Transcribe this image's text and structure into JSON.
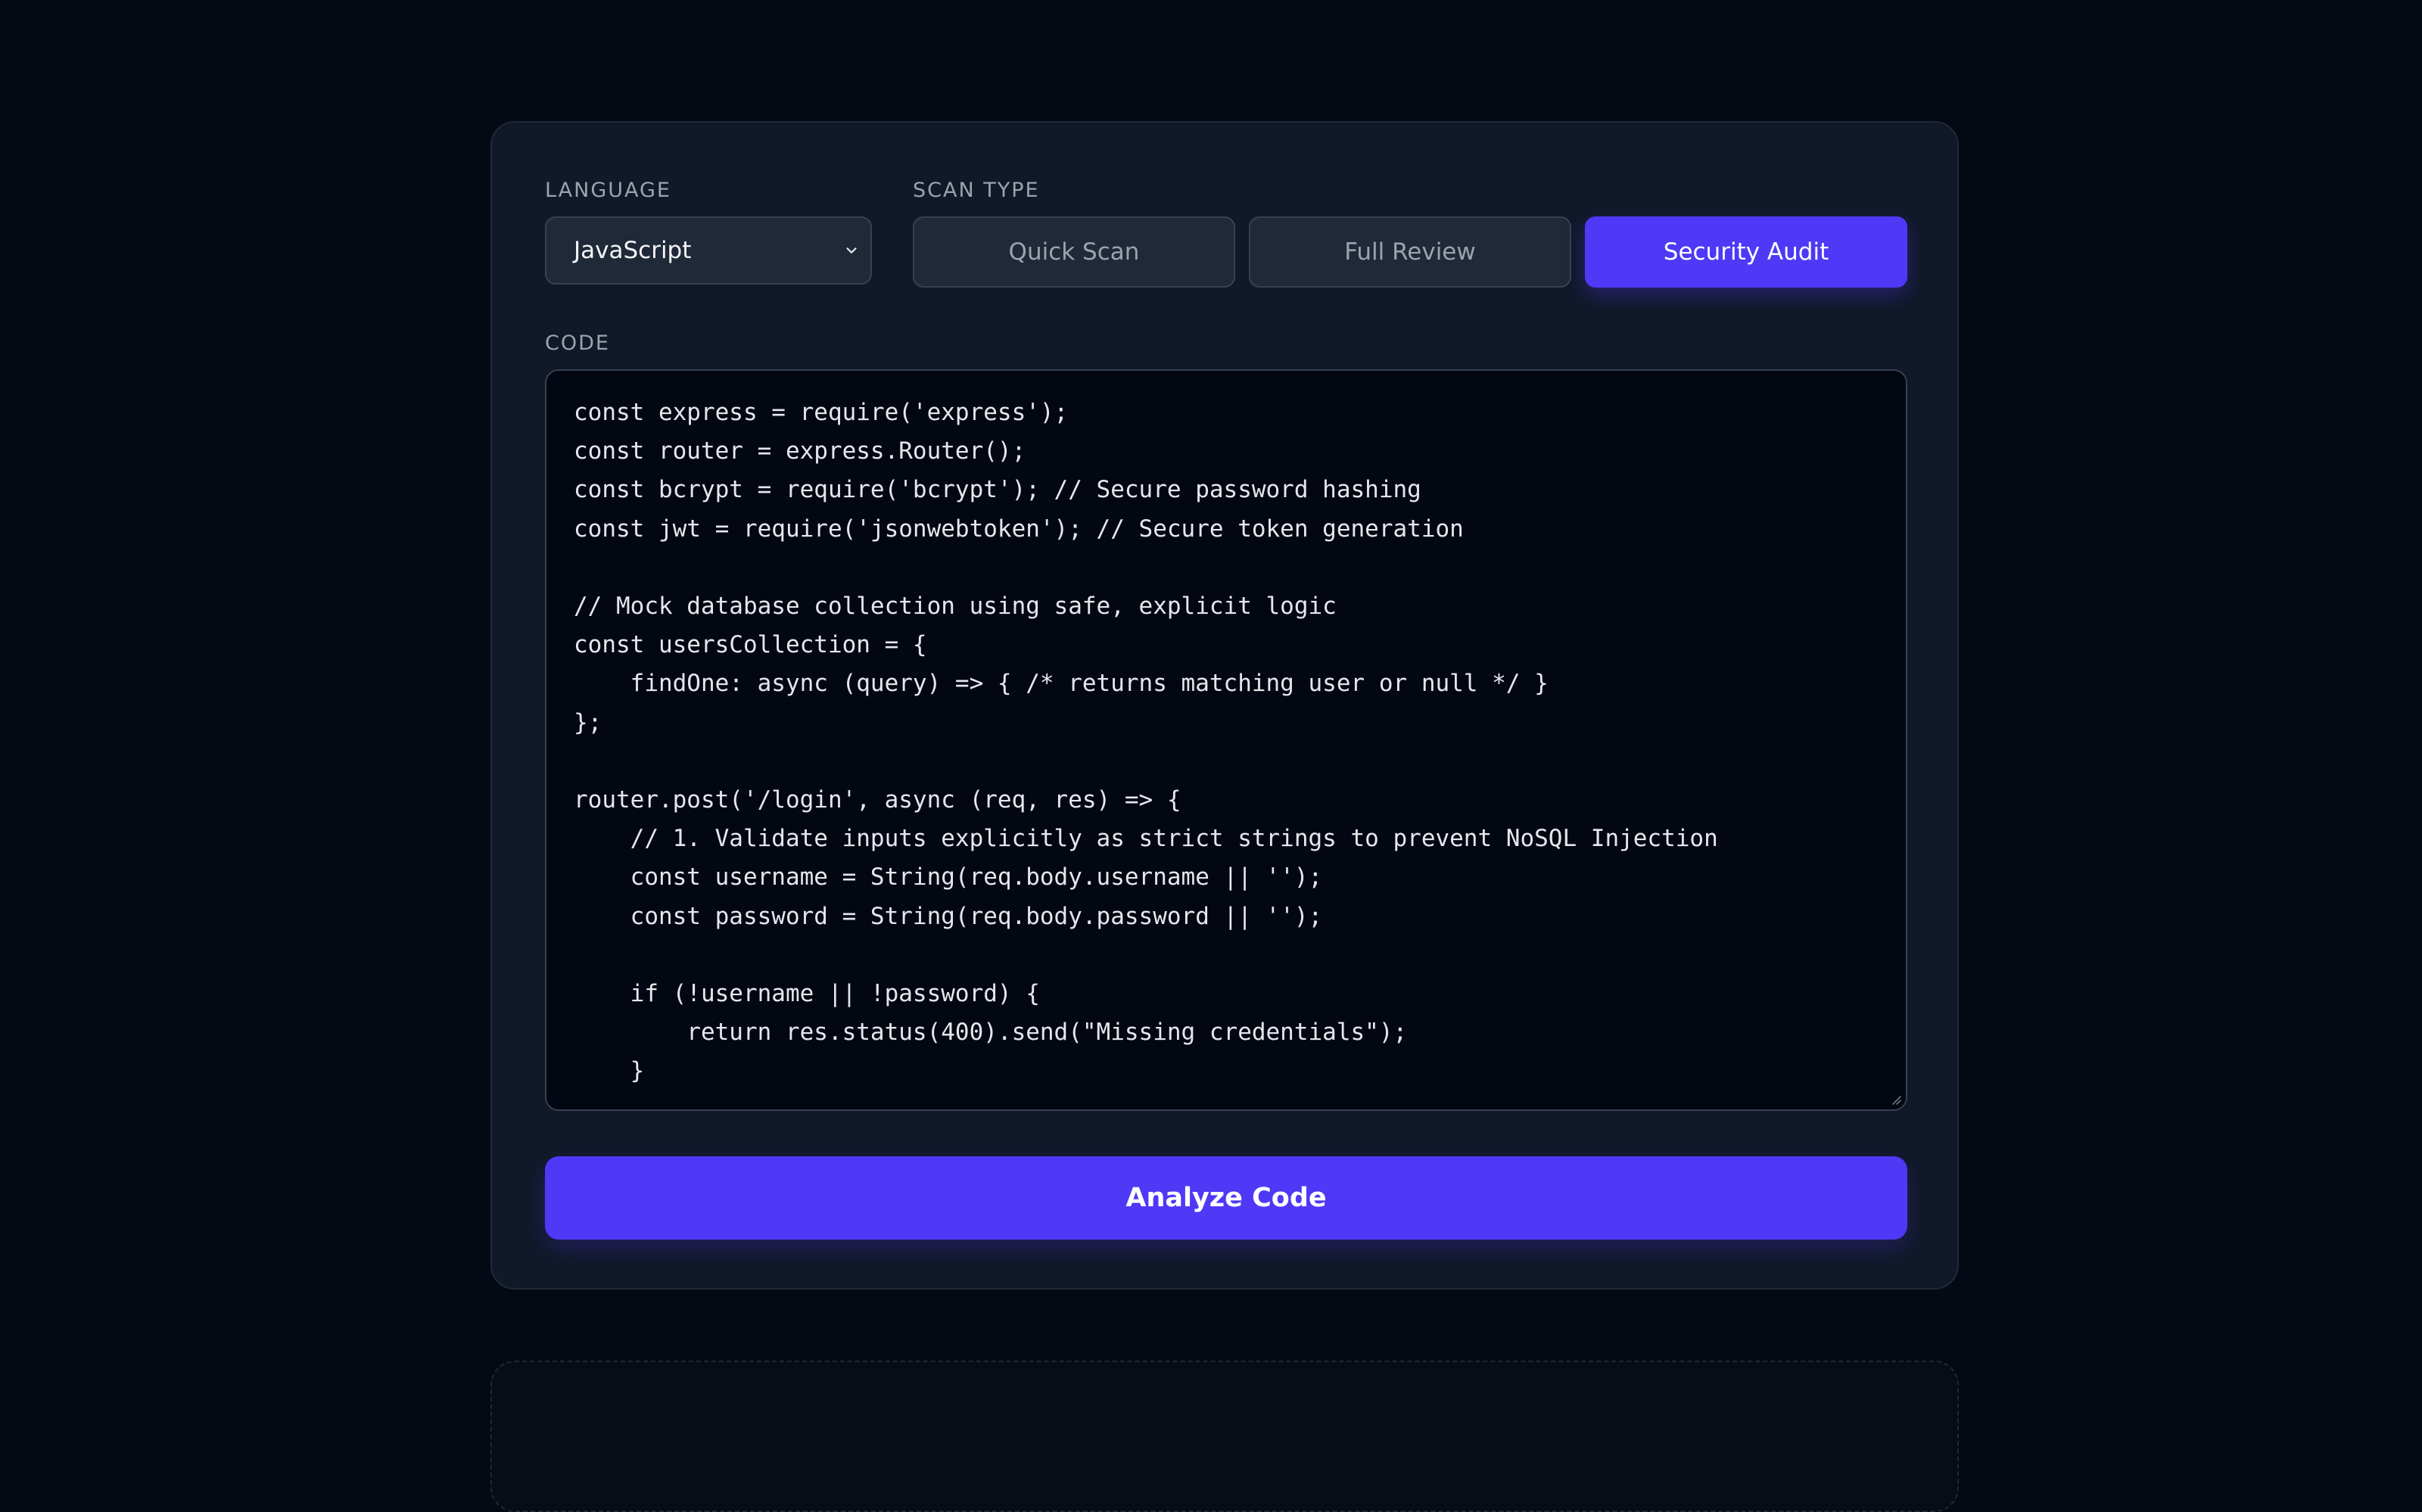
{
  "form": {
    "language_label": "LANGUAGE",
    "language_value": "JavaScript",
    "scan_type_label": "SCAN TYPE",
    "scan_types": [
      {
        "label": "Quick Scan",
        "active": false
      },
      {
        "label": "Full Review",
        "active": false
      },
      {
        "label": "Security Audit",
        "active": true
      }
    ],
    "code_label": "CODE",
    "code": "const express = require('express');\nconst router = express.Router();\nconst bcrypt = require('bcrypt'); // Secure password hashing\nconst jwt = require('jsonwebtoken'); // Secure token generation\n\n// Mock database collection using safe, explicit logic\nconst usersCollection = {\n    findOne: async (query) => { /* returns matching user or null */ }\n};\n\nrouter.post('/login', async (req, res) => {\n    // 1. Validate inputs explicitly as strict strings to prevent NoSQL Injection\n    const username = String(req.body.username || '');\n    const password = String(req.body.password || '');\n\n    if (!username || !password) {\n        return res.status(400).send(\"Missing credentials\");\n    }",
    "analyze_label": "Analyze Code"
  },
  "colors": {
    "background": "#050914",
    "panel": "#111827",
    "accent": "#4f39f6",
    "code_background": "#030712"
  },
  "icons": {
    "select_chevron": "chevron-down-icon",
    "textarea_resize": "resize-handle-icon"
  }
}
